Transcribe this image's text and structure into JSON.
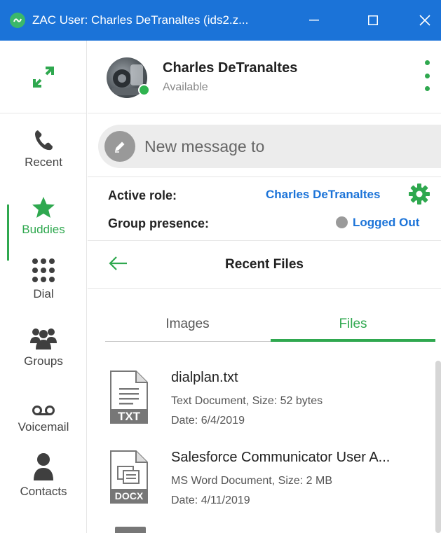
{
  "window": {
    "title": "ZAC User: Charles DeTranaltes (ids2.z...",
    "logo_icon": "zac-logo-icon",
    "controls": [
      "minimize",
      "maximize",
      "close"
    ]
  },
  "colors": {
    "titlebar": "#1b73d8",
    "accent": "#2fa84f",
    "link": "#1b73d8"
  },
  "nav": {
    "items": [
      {
        "label": "Recent",
        "icon": "phone-icon"
      },
      {
        "label": "Buddies",
        "icon": "star-icon",
        "active": true
      },
      {
        "label": "Dial",
        "icon": "dialpad-icon"
      },
      {
        "label": "Groups",
        "icon": "group-icon"
      },
      {
        "label": "Voicemail",
        "icon": "voicemail-icon"
      },
      {
        "label": "Contacts",
        "icon": "person-icon"
      }
    ]
  },
  "user": {
    "name": "Charles DeTranaltes",
    "status": "Available"
  },
  "message": {
    "placeholder": "New message to"
  },
  "roles": {
    "active_role_label": "Active role:",
    "active_role_value": "Charles DeTranaltes",
    "group_presence_label": "Group presence:",
    "group_presence_value": "Logged Out"
  },
  "recent_files": {
    "title": "Recent Files",
    "tabs": [
      {
        "label": "Images"
      },
      {
        "label": "Files",
        "active": true
      }
    ],
    "files": [
      {
        "name": "dialplan.txt",
        "type_label": "TXT",
        "meta": "Text Document, Size: 52 bytes",
        "date": "Date: 6/4/2019"
      },
      {
        "name": "Salesforce Communicator User A...",
        "type_label": "DOCX",
        "meta": "MS Word Document, Size: 2 MB",
        "date": "Date: 4/11/2019"
      }
    ]
  }
}
